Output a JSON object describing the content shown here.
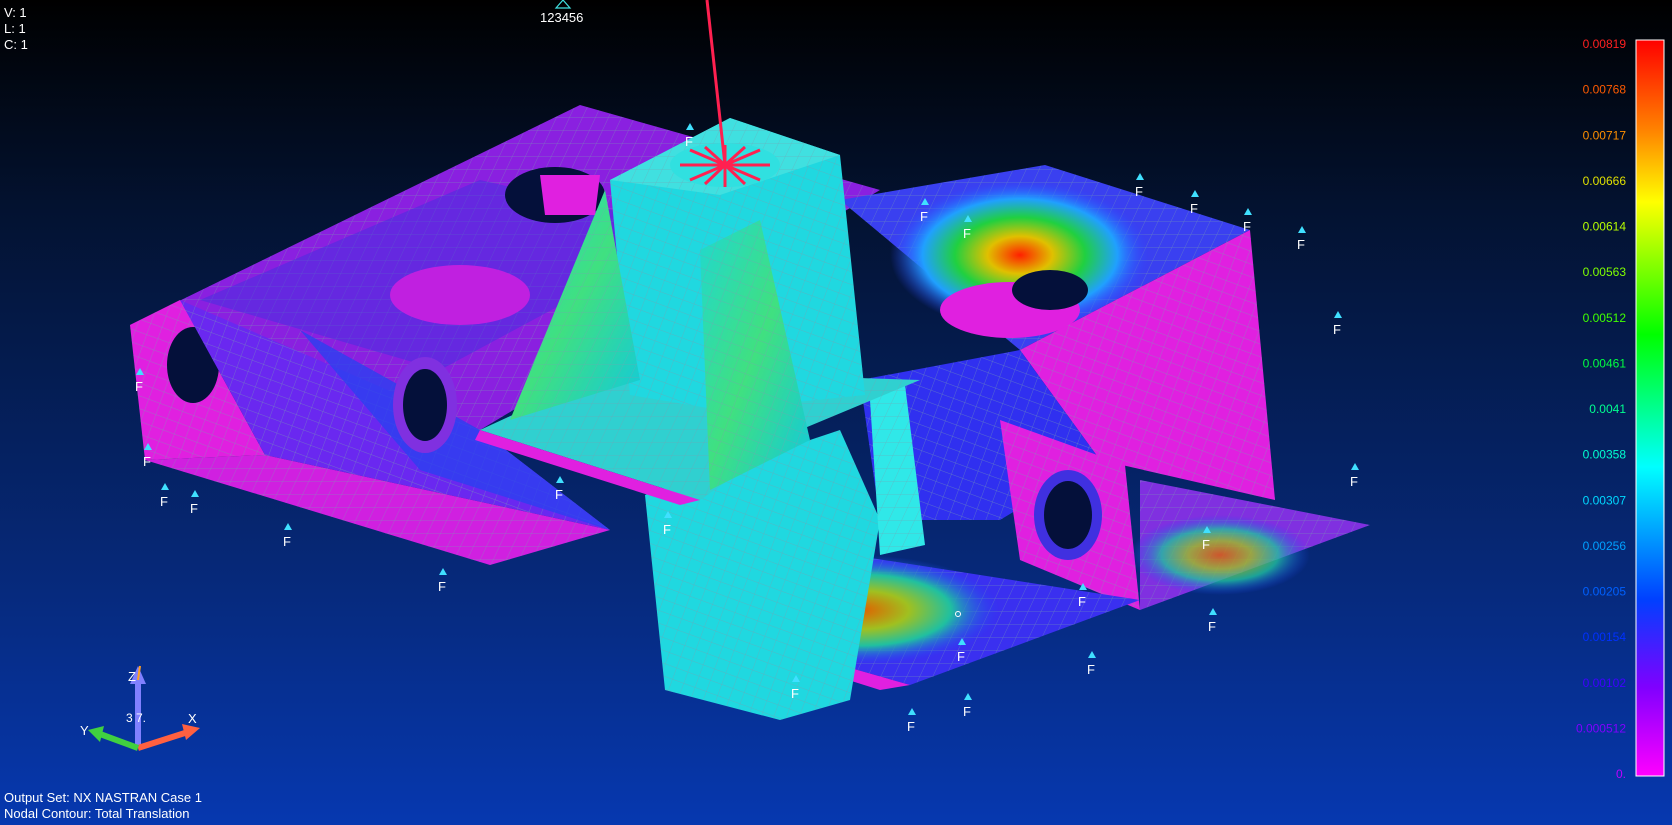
{
  "hud": {
    "view": "V: 1",
    "labels": "L: 1",
    "contour": "C: 1",
    "load_set": "123456",
    "output_set": "Output Set: NX NASTRAN Case 1",
    "nodal_contour": "Nodal Contour: Total Translation"
  },
  "triad": {
    "x_label": "X",
    "y_label": "Y",
    "z_label": "Z",
    "angle_label": "3 7."
  },
  "constraint_marker": "F",
  "colors": {
    "max": "#ff0000",
    "high": "#ff8800",
    "yellow": "#d8e000",
    "green": "#00c000",
    "cyan": "#00e0e0",
    "blue": "#2040ff",
    "violet": "#8020ff",
    "min": "#ff00ff"
  },
  "legend": {
    "values": [
      "0.00819",
      "0.00768",
      "0.00717",
      "0.00666",
      "0.00614",
      "0.00563",
      "0.00512",
      "0.00461",
      "0.0041",
      "0.00358",
      "0.00307",
      "0.00256",
      "0.00205",
      "0.00154",
      "0.00102",
      "0.000512",
      "0."
    ],
    "value_colors": [
      "#ff2020",
      "#ff5a00",
      "#ff9000",
      "#e0e000",
      "#b8ff00",
      "#80ff00",
      "#40ff00",
      "#00ff40",
      "#00ff90",
      "#00ffd0",
      "#00d8ff",
      "#00a0ff",
      "#0060ff",
      "#0030ff",
      "#4000ff",
      "#8000ff",
      "#c000ff"
    ]
  }
}
